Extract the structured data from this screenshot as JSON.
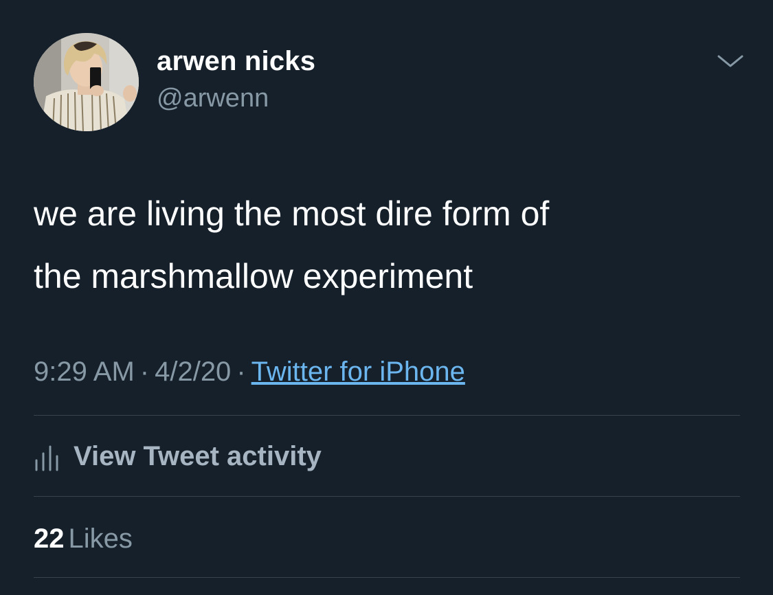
{
  "tweet": {
    "author": {
      "display_name": "arwen nicks",
      "handle": "@arwenn",
      "avatar_icon": "profile-photo"
    },
    "text_line_1": "we are living the most dire form of",
    "text_line_2": "the marshmallow experiment",
    "time": "9:29 AM",
    "date": "4/2/20",
    "separator": "·",
    "source": "Twitter for iPhone",
    "activity_label": "View Tweet activity",
    "likes_count": "22",
    "likes_label": "Likes"
  },
  "colors": {
    "background": "#15202b",
    "secondary_text": "#8899a6",
    "link": "#6cb6f0",
    "divider": "#38444d"
  }
}
